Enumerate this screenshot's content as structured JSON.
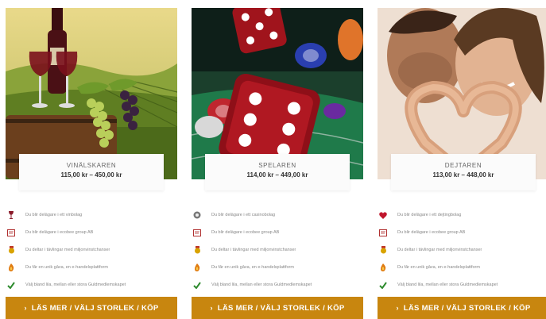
{
  "cards": [
    {
      "name": "VINÄLSKAREN",
      "price": "115,00 kr – 450,00 kr",
      "features": [
        {
          "icon": "wine-glass-icon",
          "text": "Du blir delägare i ett vinbolag"
        },
        {
          "icon": "certificate-icon",
          "text": "Du blir delägare i ecobee group AB"
        },
        {
          "icon": "medal-icon",
          "text": "Du deltar i tävlingar med miljonvinstchanser"
        },
        {
          "icon": "flame-icon",
          "text": "Du får en unik gåva, en e-handelsplattform"
        },
        {
          "icon": "checkmark-icon",
          "text": "Välj bland lila, mellan eller stora Guldmedlemskapet"
        }
      ],
      "cta": "LÄS MER / VÄLJ STORLEK / KÖP"
    },
    {
      "name": "SPELAREN",
      "price": "114,00 kr – 449,00 kr",
      "features": [
        {
          "icon": "chip-icon",
          "text": "Du blir delägare i ett casinobolag"
        },
        {
          "icon": "certificate-icon",
          "text": "Du blir delägare i ecobee group AB"
        },
        {
          "icon": "medal-icon",
          "text": "Du deltar i tävlingar med miljonvinstchanser"
        },
        {
          "icon": "flame-icon",
          "text": "Du får en unik gåva, en e-handelsplattform"
        },
        {
          "icon": "checkmark-icon",
          "text": "Välj bland lila, mellan eller stora Guldmedlemskapet"
        }
      ],
      "cta": "LÄS MER / VÄLJ STORLEK / KÖP"
    },
    {
      "name": "DEJTAREN",
      "price": "113,00 kr – 448,00 kr",
      "features": [
        {
          "icon": "heart-icon",
          "text": "Du blir delägare i ett dejtingbolag"
        },
        {
          "icon": "certificate-icon",
          "text": "Du blir delägare i ecobee group AB"
        },
        {
          "icon": "medal-icon",
          "text": "Du deltar i tävlingar med miljonvinstchanser"
        },
        {
          "icon": "flame-icon",
          "text": "Du får en unik gåva, en e-handelsplattform"
        },
        {
          "icon": "checkmark-icon",
          "text": "Välj bland lila, mellan eller stora Guldmedlemskapet"
        }
      ],
      "cta": "LÄS MER / VÄLJ STORLEK / KÖP"
    }
  ],
  "colors": {
    "cta_background": "#c8860f",
    "cta_text": "#ffffff",
    "checkmark": "#2e8b2e",
    "heart": "#c0162c",
    "medal": "#d9a300",
    "flame": "#e07a10"
  }
}
